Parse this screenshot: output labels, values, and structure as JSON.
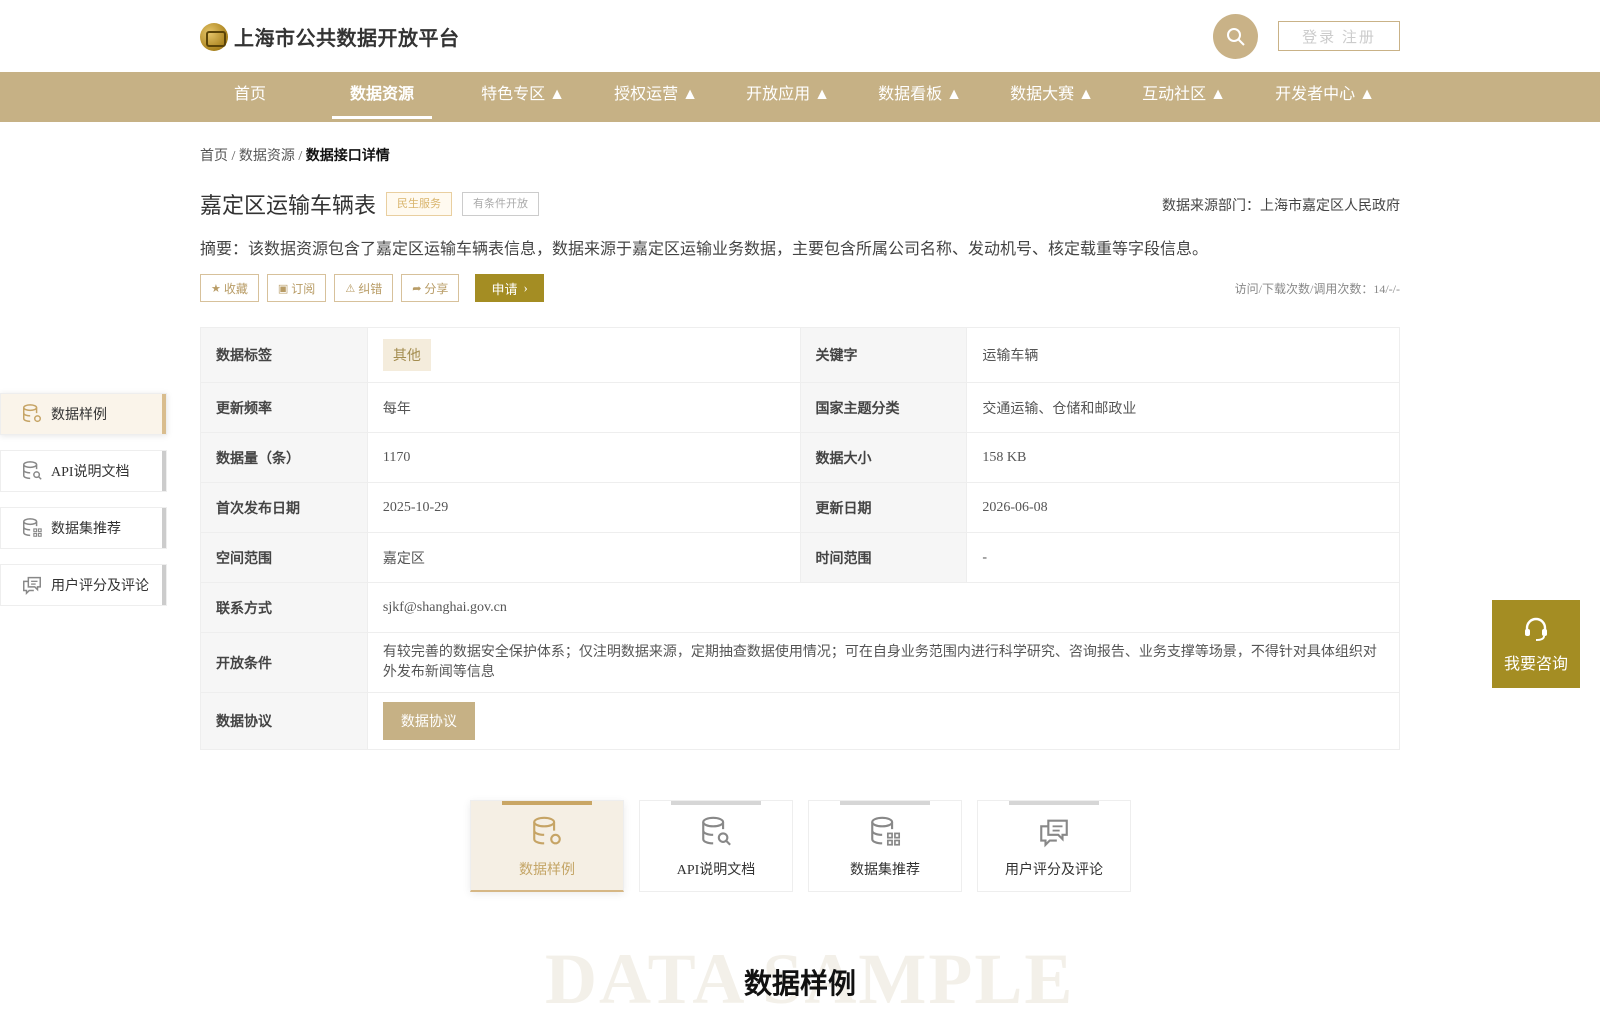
{
  "header": {
    "site_title": "上海市公共数据开放平台",
    "login_label": "登录 注册"
  },
  "nav": {
    "items": [
      {
        "label": "首页"
      },
      {
        "label": "数据资源"
      },
      {
        "label": "特色专区 ▲"
      },
      {
        "label": "授权运营 ▲"
      },
      {
        "label": "开放应用 ▲"
      },
      {
        "label": "数据看板 ▲"
      },
      {
        "label": "数据大赛 ▲"
      },
      {
        "label": "互动社区 ▲"
      },
      {
        "label": "开发者中心 ▲"
      }
    ],
    "active_index": 1
  },
  "breadcrumb": {
    "home": "首页",
    "sep1": " / ",
    "section": "数据资源",
    "sep2": " / ",
    "current": "数据接口详情"
  },
  "dataset": {
    "title": "嘉定区运输车辆表",
    "tag1": "民生服务",
    "tag2": "有条件开放",
    "source": "数据来源部门：上海市嘉定区人民政府",
    "abstract": "摘要：该数据资源包含了嘉定区运输车辆表信息，数据来源于嘉定区运输业务数据，主要包含所属公司名称、发动机号、核定载重等字段信息。"
  },
  "actions": {
    "collect": "收藏",
    "subscribe": "订阅",
    "report": "纠错",
    "share": "分享",
    "apply": "申请",
    "visits": "访问/下载次数/调用次数：14/-/-"
  },
  "info": {
    "tag_label": "数据标签",
    "tag_value": "其他",
    "keyword_label": "关键字",
    "keyword_value": "运输车辆",
    "freq_label": "更新频率",
    "freq_value": "每年",
    "theme_label": "国家主题分类",
    "theme_value": "交通运输、仓储和邮政业",
    "count_label": "数据量（条）",
    "count_value": "1170",
    "size_label": "数据大小",
    "size_value": "158 KB",
    "first_label": "首次发布日期",
    "first_value": "2025-10-29",
    "update_label": "更新日期",
    "update_value": "2026-06-08",
    "space_label": "空间范围",
    "space_value": "嘉定区",
    "time_label": "时间范围",
    "time_value": "-",
    "contact_label": "联系方式",
    "contact_value": "sjkf@shanghai.gov.cn",
    "cond_label": "开放条件",
    "cond_value": "有较完善的数据安全保护体系；仅注明数据来源，定期抽查数据使用情况；可在自身业务范围内进行科学研究、咨询报告、业务支撑等场景，不得针对具体组织对外发布新闻等信息",
    "proto_label": "数据协议",
    "proto_button": "数据协议"
  },
  "sidebar": {
    "items": [
      {
        "label": "数据样例",
        "icon": "database-gear-icon"
      },
      {
        "label": "API说明文档",
        "icon": "database-search-icon"
      },
      {
        "label": "数据集推荐",
        "icon": "database-grid-icon"
      },
      {
        "label": "用户评分及评论",
        "icon": "chat-bubbles-icon"
      }
    ],
    "active_index": 0
  },
  "tabs": {
    "items": [
      {
        "label": "数据样例"
      },
      {
        "label": "API说明文档"
      },
      {
        "label": "数据集推荐"
      },
      {
        "label": "用户评分及评论"
      }
    ],
    "active_index": 0
  },
  "consult": {
    "label": "我要咨询"
  },
  "section": {
    "bg_text": "DATA SAMPLE",
    "title": "数据样例"
  },
  "colors": {
    "brand_gold": "#c6b185",
    "apply_olive": "#a48d23"
  }
}
